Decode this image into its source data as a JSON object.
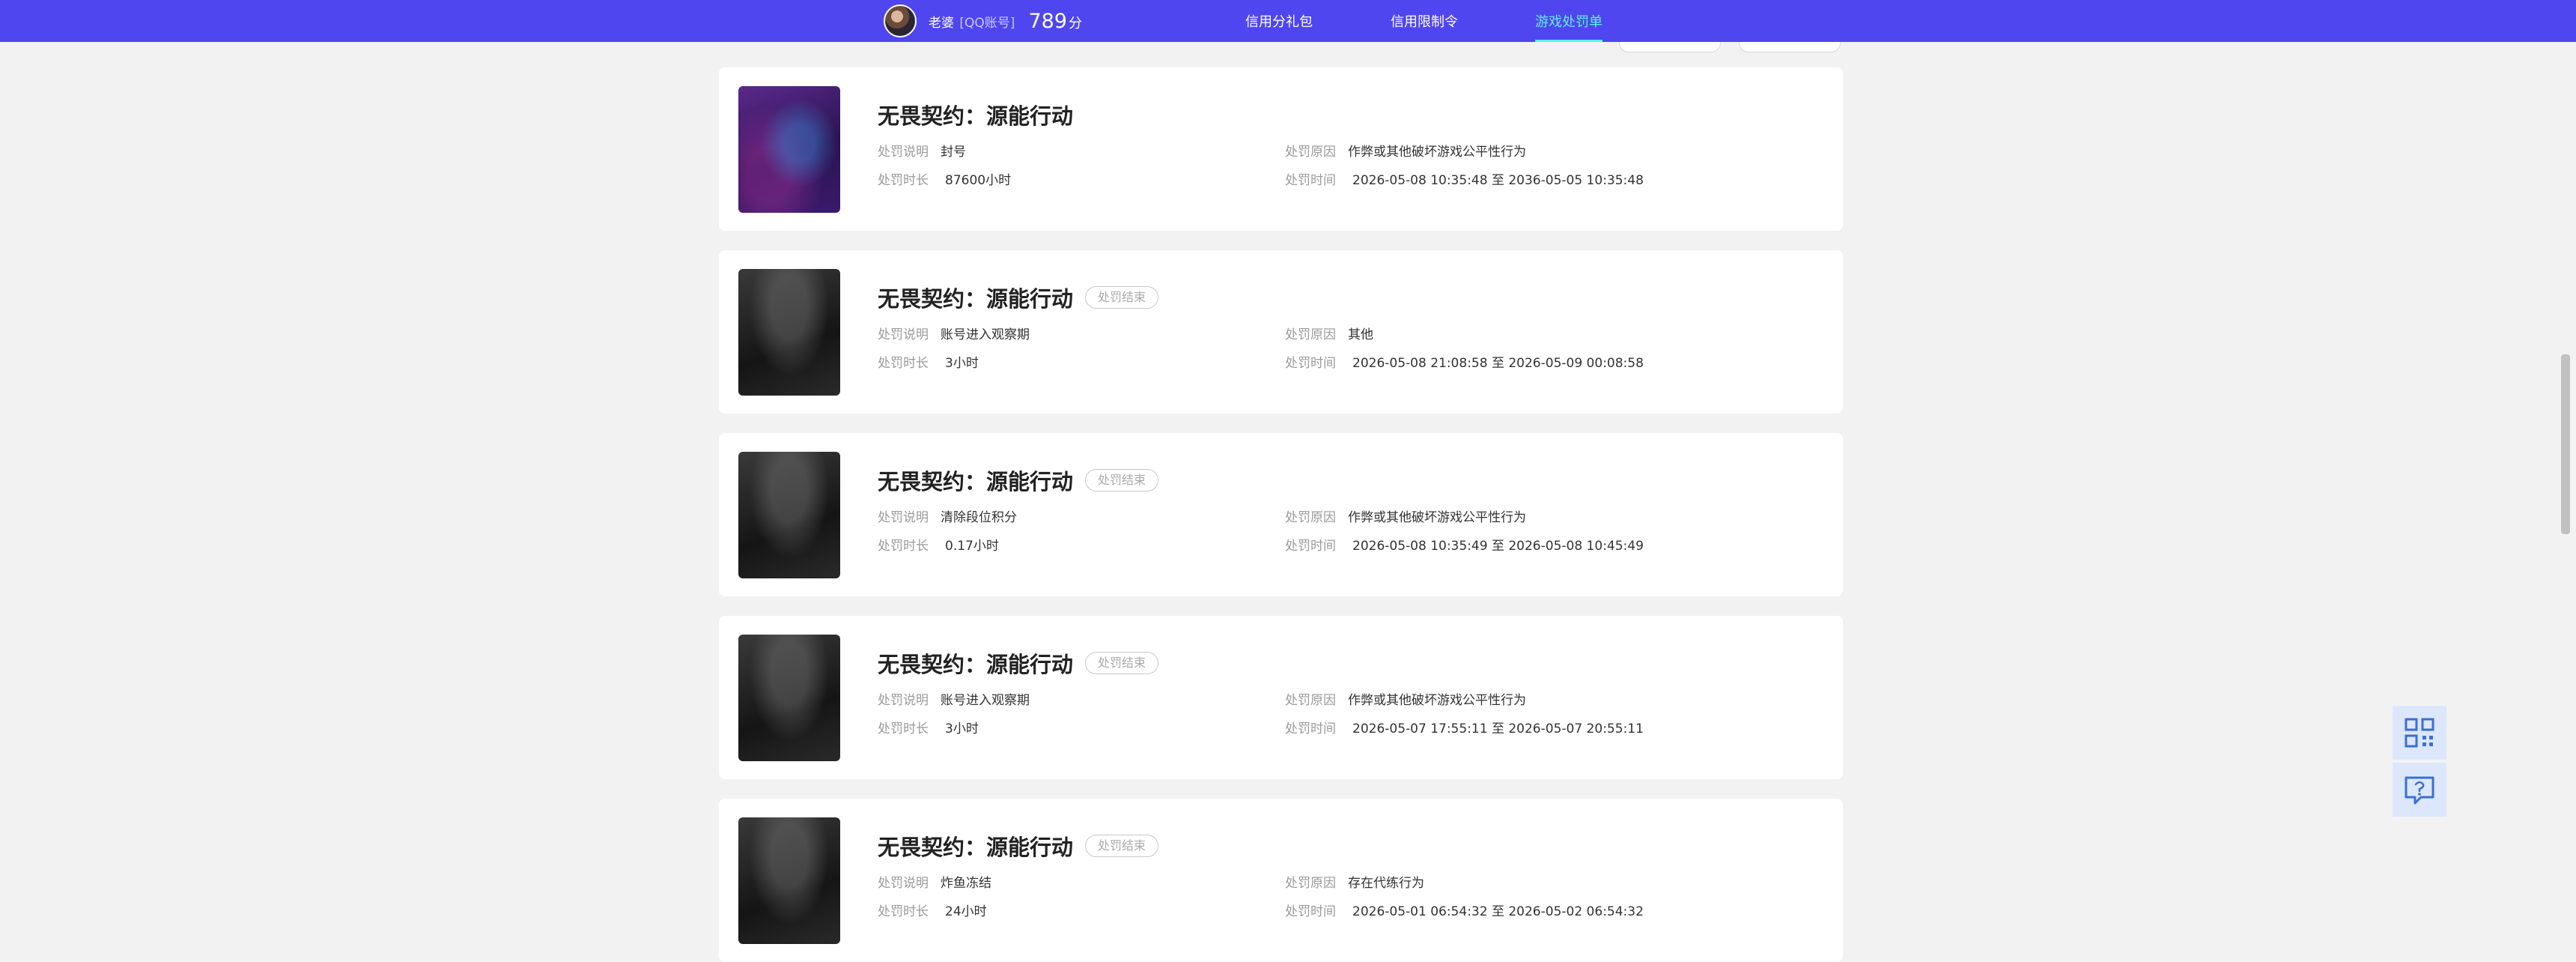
{
  "header": {
    "user_name": "老婆",
    "account_type": "[QQ账号]",
    "score": "789",
    "score_unit": "分",
    "nav": [
      {
        "label": "信用分礼包",
        "active": false
      },
      {
        "label": "信用限制令",
        "active": false
      },
      {
        "label": "游戏处罚单",
        "active": true
      }
    ],
    "accent": "#4f46f0",
    "active_color": "#5ff1f0"
  },
  "records": [
    {
      "game": "无畏契约：源能行动",
      "status": "",
      "desc_label": "处罚说明",
      "desc": "封号",
      "duration_label": "处罚时长",
      "duration": "87600小时",
      "reason_label": "处罚原因",
      "reason": "作弊或其他破坏游戏公平性行为",
      "time_label": "处罚时间",
      "time": "2026-05-08 10:35:48 至 2036-05-05 10:35:48"
    },
    {
      "game": "无畏契约：源能行动",
      "status": "处罚结束",
      "desc_label": "处罚说明",
      "desc": "账号进入观察期",
      "duration_label": "处罚时长",
      "duration": "3小时",
      "reason_label": "处罚原因",
      "reason": "其他",
      "time_label": "处罚时间",
      "time": "2026-05-08 21:08:58 至 2026-05-09 00:08:58"
    },
    {
      "game": "无畏契约：源能行动",
      "status": "处罚结束",
      "desc_label": "处罚说明",
      "desc": "清除段位积分",
      "duration_label": "处罚时长",
      "duration": "0.17小时",
      "reason_label": "处罚原因",
      "reason": "作弊或其他破坏游戏公平性行为",
      "time_label": "处罚时间",
      "time": "2026-05-08 10:35:49 至 2026-05-08 10:45:49"
    },
    {
      "game": "无畏契约：源能行动",
      "status": "处罚结束",
      "desc_label": "处罚说明",
      "desc": "账号进入观察期",
      "duration_label": "处罚时长",
      "duration": "3小时",
      "reason_label": "处罚原因",
      "reason": "作弊或其他破坏游戏公平性行为",
      "time_label": "处罚时间",
      "time": "2026-05-07 17:55:11 至 2026-05-07 20:55:11"
    },
    {
      "game": "无畏契约：源能行动",
      "status": "处罚结束",
      "desc_label": "处罚说明",
      "desc": "炸鱼冻结",
      "duration_label": "处罚时长",
      "duration": "24小时",
      "reason_label": "处罚原因",
      "reason": "存在代练行为",
      "time_label": "处罚时间",
      "time": "2026-05-01 06:54:32 至 2026-05-02 06:54:32"
    }
  ],
  "tools": {
    "qr_icon": "qr-code-icon",
    "help_icon": "help-question-icon"
  }
}
